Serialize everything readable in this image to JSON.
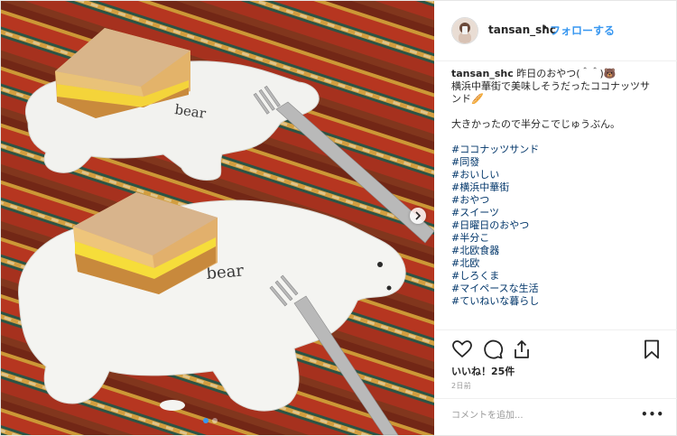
{
  "post": {
    "username": "tansan_shc",
    "separator": "•",
    "follow_label": "フォローする"
  },
  "caption": {
    "username": "tansan_shc",
    "line1": "昨日のおやつ(＾＾)🐻",
    "line2": "横浜中華街で美味しそうだったココナッツサ",
    "line3": "ンド🥖",
    "line4": "大きかったので半分こでじゅうぶん。",
    "hashtags": [
      "#ココナッツサンド",
      "#同發",
      "#おいしい",
      "#横浜中華街",
      "#おやつ",
      "#スイーツ",
      "#日曜日のおやつ",
      "#半分こ",
      "#北欧食器",
      "#北欧",
      "#しろくま",
      "#マイペースな生活",
      "#ていねいな暮らし"
    ]
  },
  "stats": {
    "likes": "いいね！25件",
    "time": "2日前"
  },
  "comment": {
    "placeholder": "コメントを追加...",
    "more_label": "•••"
  },
  "photo": {
    "plate_text_top": "bear",
    "plate_text_bottom": "bear"
  },
  "icons": {
    "like": "heart-icon",
    "comment": "comment-icon",
    "share": "share-icon",
    "save": "bookmark-icon",
    "next": "chevron-right-icon"
  },
  "colors": {
    "link": "#3897f0",
    "hashtag": "#003569",
    "text": "#262626",
    "muted": "#999999"
  }
}
